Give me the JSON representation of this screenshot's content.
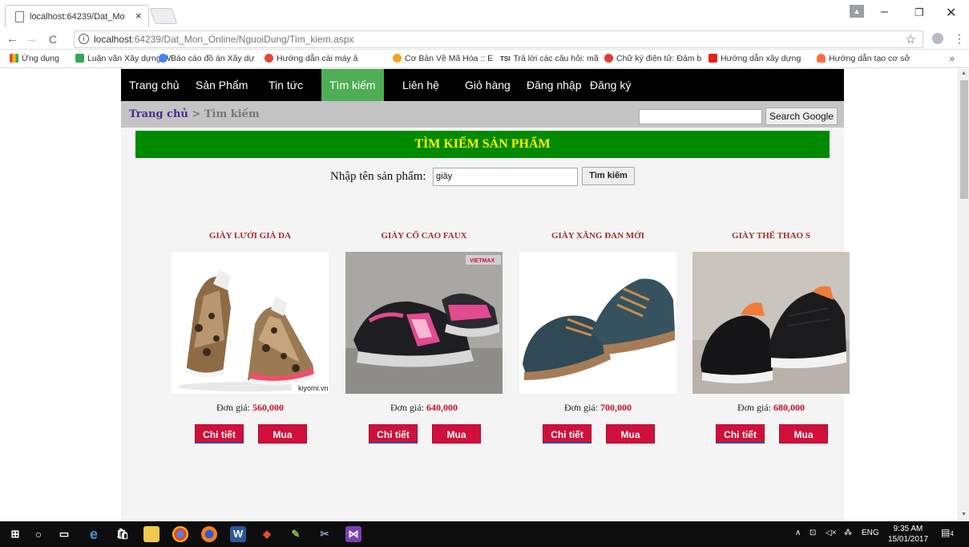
{
  "browser": {
    "tab_title": "localhost:64239/Dat_Mo",
    "tab_close": "×",
    "url_host": "localhost",
    "url_path": ":64239/Dat_Mon_Online/NguoiDung/Tim_kiem.aspx",
    "bookmarks": [
      {
        "label": "Ứng dụng",
        "color": "#f4b400"
      },
      {
        "label": "Luận văn Xây dựng W",
        "color": "#34a853"
      },
      {
        "label": "Báo cáo đồ án Xây dự",
        "color": "#4285f4"
      },
      {
        "label": "Hướng dẫn cài máy ả",
        "color": "#ea4335"
      },
      {
        "label": "Cơ Bản Về Mã Hóa :: E",
        "color": "#f4a21f"
      },
      {
        "label": "Trả lời các câu hỏi: mã",
        "color": "#555555"
      },
      {
        "label": "Chữ ký điện tử: Đảm b",
        "color": "#e53935"
      },
      {
        "label": "Hướng dẫn xây dựng",
        "color": "#e62117"
      },
      {
        "label": "Hướng dẫn tạo cơ sở",
        "color": "#ff7043"
      }
    ],
    "bookmarks_more": "»",
    "tsi_label": "TSI"
  },
  "site": {
    "nav": [
      {
        "label": "Trang chủ",
        "active": false
      },
      {
        "label": "Sản Phẩm",
        "active": false
      },
      {
        "label": "Tin tức",
        "active": false
      },
      {
        "label": "Tìm kiếm",
        "active": true
      },
      {
        "label": "Liên hệ",
        "active": false
      },
      {
        "label": "Giỏ hàng",
        "active": false
      },
      {
        "label": "Đăng nhập",
        "active": false
      },
      {
        "label": "Đăng ký",
        "active": false
      }
    ],
    "breadcrumb_home": "Trang chủ",
    "breadcrumb_sep": " > ",
    "breadcrumb_current": "Tìm kiếm",
    "google_search_value": "",
    "google_search_button": "Search Google",
    "banner_title": "TÌM KIẾM SẢN PHẨM",
    "search_label": "Nhập tên sản phẩm:",
    "search_value": "giày",
    "search_button": "Tìm kiếm",
    "price_label": "Đơn giá:",
    "detail_label": "Chi tiết",
    "buy_label": "Mua",
    "products": [
      {
        "name": "GIÀY LƯỚI GIẢ DA",
        "price": "560,000",
        "watermark": "kiyomi.vn"
      },
      {
        "name": "GIÀY CỔ CAO FAUX",
        "price": "640,000",
        "watermark": "VIETMAX"
      },
      {
        "name": "GIÀY XĂNG ĐAN MỚI",
        "price": "700,000",
        "watermark": ""
      },
      {
        "name": "GIÀY THỂ THAO S",
        "price": "680,000",
        "watermark": ""
      }
    ]
  },
  "taskbar": {
    "lang": "ENG",
    "time": "9:35 AM",
    "date": "15/01/2017",
    "notifications": "4"
  },
  "colors": {
    "nav_active": "#4fae55",
    "banner_bg": "#008a00",
    "banner_text": "#fff200",
    "price": "#c8102e",
    "button": "#d0103a",
    "product_name": "#a0322d"
  }
}
